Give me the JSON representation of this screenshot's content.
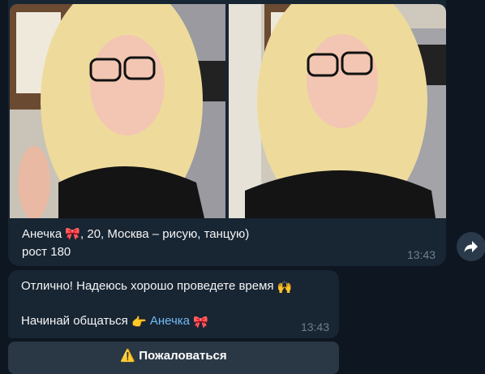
{
  "message1": {
    "caption_line1": "Анечка 🎀, 20, Москва – рисую, танцую)",
    "caption_line2": "рост 180",
    "time": "13:43"
  },
  "message2": {
    "line1_text": "Отлично! Надеюсь хорошо проведете время",
    "line1_emoji": "🙌",
    "line2_text": "Начинай общаться",
    "line2_emoji": "👉",
    "mention": "Анечка",
    "mention_emoji": "🎀",
    "time": "13:43"
  },
  "keyboard_button": {
    "label": "⚠️ Пожаловаться"
  },
  "icons": {
    "share": "share-arrow-icon"
  },
  "colors": {
    "background": "#0e1621",
    "bubble": "#182533",
    "link": "#71baf5",
    "timestamp": "#6d7f8f"
  }
}
